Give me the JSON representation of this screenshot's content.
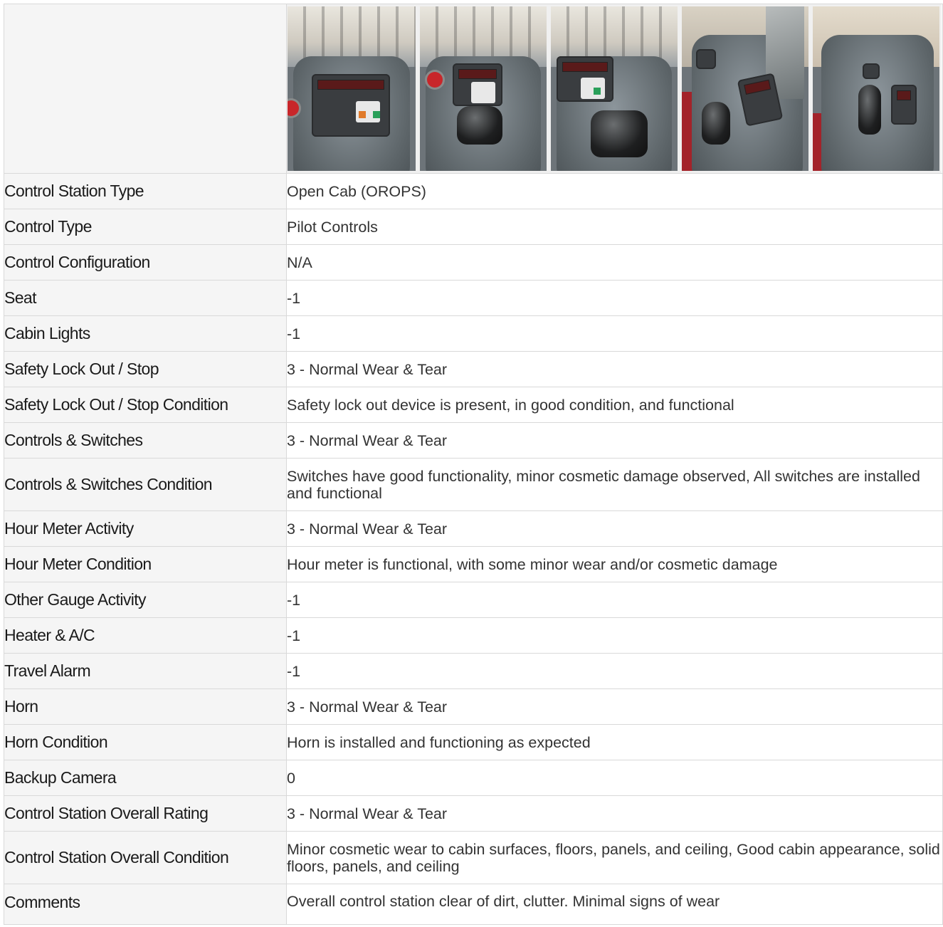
{
  "photos": [
    {
      "icon": "forklift-control-panel-photo"
    },
    {
      "icon": "forklift-joystick-photo"
    },
    {
      "icon": "forklift-joystick-closeup-photo"
    },
    {
      "icon": "forklift-console-side-photo"
    },
    {
      "icon": "forklift-cab-overview-photo"
    }
  ],
  "rows": [
    {
      "label": "Control Station Type",
      "value": "Open Cab (OROPS)"
    },
    {
      "label": "Control Type",
      "value": "Pilot Controls"
    },
    {
      "label": "Control Configuration",
      "value": "N/A"
    },
    {
      "label": "Seat",
      "value": "-1"
    },
    {
      "label": "Cabin Lights",
      "value": "-1"
    },
    {
      "label": "Safety Lock Out / Stop",
      "value": "3 - Normal Wear & Tear"
    },
    {
      "label": "Safety Lock Out / Stop Condition",
      "value": "Safety lock out device is present, in good condition, and functional"
    },
    {
      "label": "Controls & Switches",
      "value": "3 - Normal Wear & Tear"
    },
    {
      "label": "Controls & Switches Condition",
      "value": "Switches have good functionality, minor cosmetic damage observed, All switches are installed and functional"
    },
    {
      "label": "Hour Meter Activity",
      "value": "3 - Normal Wear & Tear"
    },
    {
      "label": "Hour Meter Condition",
      "value": "Hour meter is functional, with some minor wear and/or cosmetic damage"
    },
    {
      "label": "Other Gauge Activity",
      "value": "-1"
    },
    {
      "label": "Heater & A/C",
      "value": "-1"
    },
    {
      "label": "Travel Alarm",
      "value": "-1"
    },
    {
      "label": "Horn",
      "value": "3 - Normal Wear & Tear"
    },
    {
      "label": "Horn Condition",
      "value": "Horn is installed and functioning as expected"
    },
    {
      "label": "Backup Camera",
      "value": "0"
    },
    {
      "label": "Control Station Overall Rating",
      "value": "3 - Normal Wear & Tear"
    },
    {
      "label": "Control Station Overall Condition",
      "value": "Minor cosmetic wear to cabin surfaces, floors, panels, and ceiling, Good cabin appearance, solid floors, panels, and ceiling"
    },
    {
      "label": "Comments",
      "value": "Overall control station clear of dirt, clutter. Minimal signs of wear"
    }
  ]
}
